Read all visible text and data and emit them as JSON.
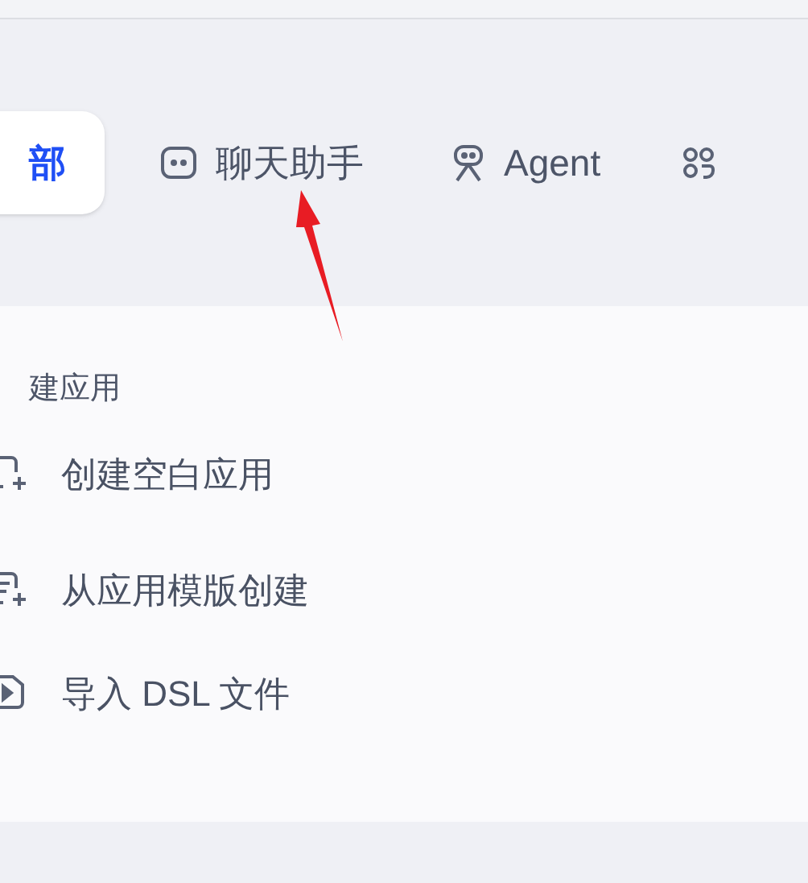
{
  "tabs": [
    {
      "label": "部",
      "kind": "all",
      "selected": true
    },
    {
      "label": "聊天助手",
      "kind": "chat",
      "selected": false
    },
    {
      "label": "Agent",
      "kind": "agent",
      "selected": false
    },
    {
      "kind": "workflow",
      "selected": false
    }
  ],
  "create_panel": {
    "title": "建应用",
    "items": [
      {
        "label": "创建空白应用",
        "kind": "blank"
      },
      {
        "label": "从应用模版创建",
        "kind": "template"
      },
      {
        "label": "导入 DSL 文件",
        "kind": "import"
      }
    ]
  }
}
